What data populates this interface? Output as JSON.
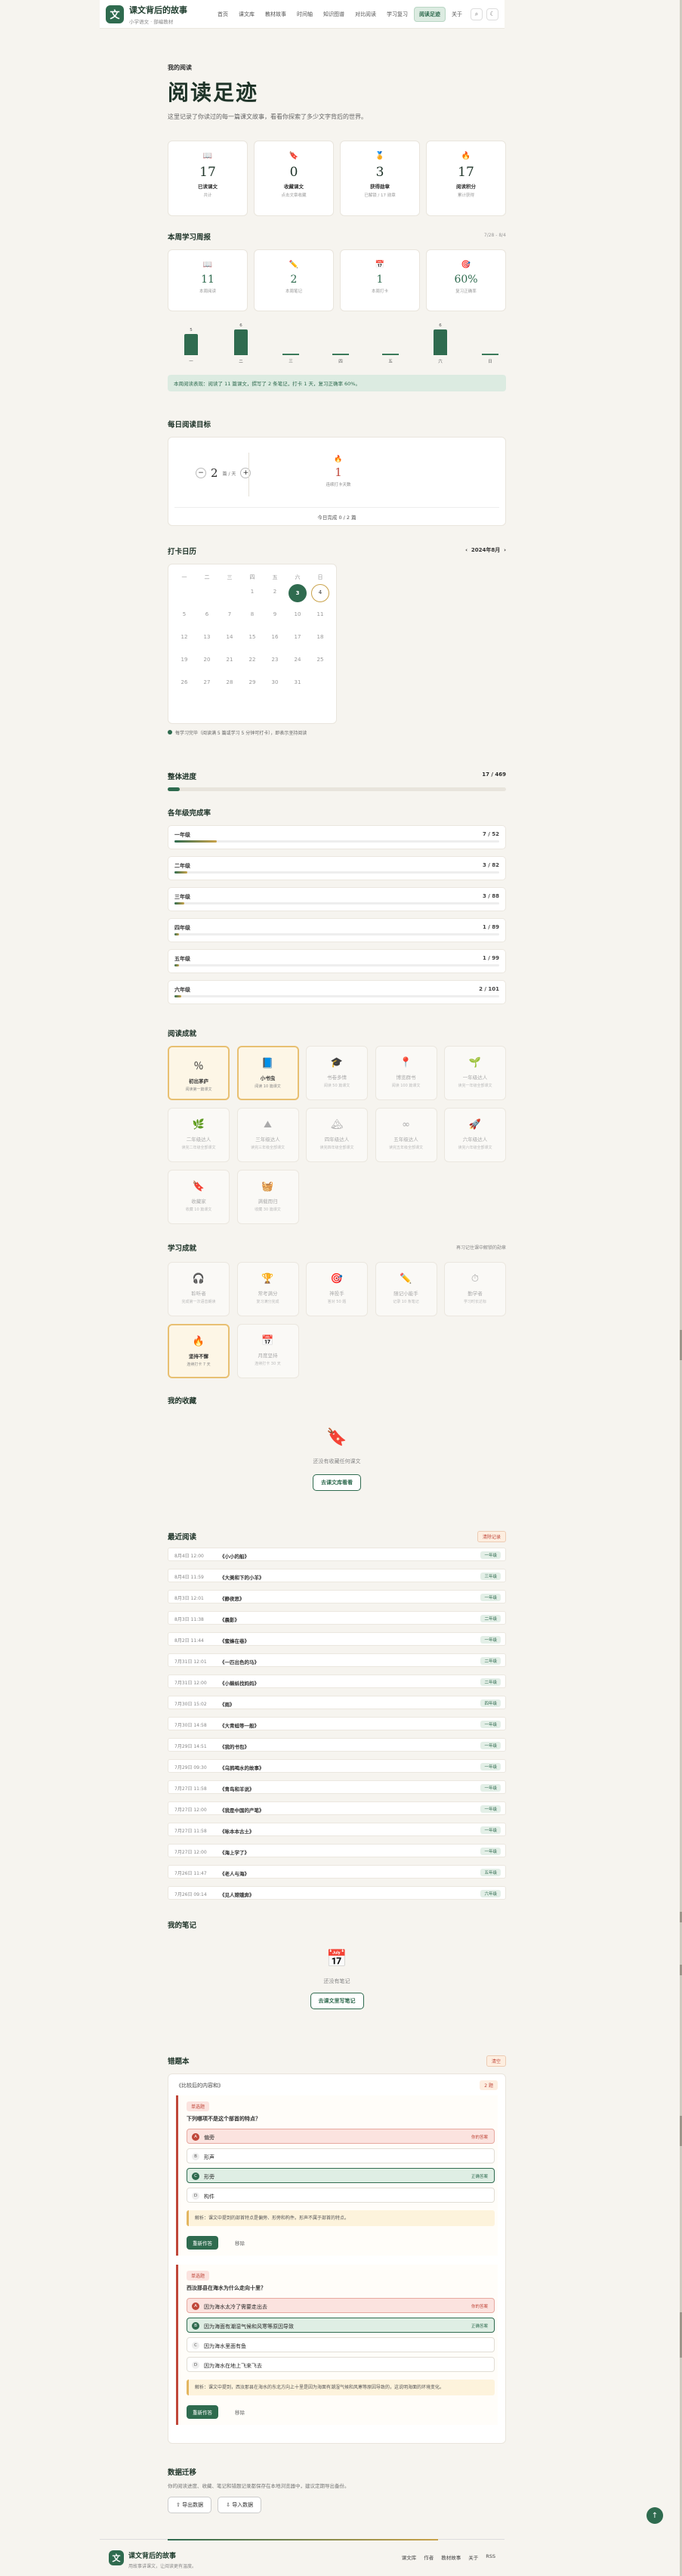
{
  "app": {
    "title": "课文背后的故事",
    "subtitle": "小学语文 · 部编教材"
  },
  "nav": [
    "首页",
    "课文库",
    "教材故事",
    "时间轴",
    "知识图谱",
    "对比阅读",
    "学习复习",
    "阅读足迹",
    "关于"
  ],
  "nav_active": "阅读足迹",
  "hero": {
    "kicker": "我的阅读",
    "title": "阅读足迹",
    "lead": "这里记录了你读过的每一篇课文故事，看看你探索了多少文字背后的世界。"
  },
  "stats": [
    {
      "icon": "📖",
      "num": "17",
      "label": "已读课文",
      "desc": "共计"
    },
    {
      "icon": "🔖",
      "num": "0",
      "label": "收藏课文",
      "desc": "点击文章收藏"
    },
    {
      "icon": "🏅",
      "num": "3",
      "label": "获得勋章",
      "desc": "已解锁 / 17 勋章"
    },
    {
      "icon": "🔥",
      "num": "17",
      "label": "阅读积分",
      "desc": "累计获得"
    }
  ],
  "week": {
    "title": "本周学习周报",
    "range": "7/28 - 8/4",
    "cards": [
      {
        "icon": "📖",
        "num": "11",
        "label": "本周阅读"
      },
      {
        "icon": "✏️",
        "num": "2",
        "label": "本周笔记"
      },
      {
        "icon": "📅",
        "num": "1",
        "label": "本周打卡"
      },
      {
        "icon": "🎯",
        "num": "60%",
        "label": "复习正确率"
      }
    ],
    "chart": {
      "days": [
        "一",
        "二",
        "三",
        "四",
        "五",
        "六",
        "日"
      ],
      "values": [
        5,
        6,
        0,
        0,
        0,
        6,
        0
      ]
    },
    "summary": "本周阅读表现：阅读了 11 篇课文，撰写了 2 条笔记，打卡 1 天，复习正确率 60%。"
  },
  "goal": {
    "title": "每日阅读目标",
    "value": "2",
    "unit": "篇 / 天",
    "flame": "🔥",
    "count": "1",
    "count_label": "连续打卡天数",
    "progress": "今日完成 0 / 2 篇"
  },
  "checkin": {
    "title": "打卡日历",
    "month": "2024年8月",
    "weekdays": [
      "一",
      "二",
      "三",
      "四",
      "五",
      "六",
      "日"
    ],
    "note": "每学习完毕（阅读满 5 篇或学习 5 分钟可打卡），即表示坚持阅读"
  },
  "overall": {
    "title": "整体进度",
    "value": "17 / 469",
    "pct": 3.6
  },
  "grades": {
    "title": "各年级完成率",
    "items": [
      {
        "name": "一年级",
        "value": "7 / 52",
        "pct": 13
      },
      {
        "name": "二年级",
        "value": "3 / 82",
        "pct": 4
      },
      {
        "name": "三年级",
        "value": "3 / 88",
        "pct": 3
      },
      {
        "name": "四年级",
        "value": "1 / 89",
        "pct": 1
      },
      {
        "name": "五年级",
        "value": "1 / 99",
        "pct": 1
      },
      {
        "name": "六年级",
        "value": "2 / 101",
        "pct": 2
      }
    ]
  },
  "achievements": {
    "title": "阅读成就",
    "items": [
      {
        "icon": "％",
        "name": "初出茅庐",
        "desc": "阅读第一篇课文",
        "on": true
      },
      {
        "icon": "📘",
        "name": "小书虫",
        "desc": "阅读 10 篇课文",
        "on": true
      },
      {
        "icon": "🎓",
        "name": "书卷多情",
        "desc": "阅读 50 篇课文",
        "on": false
      },
      {
        "icon": "📍",
        "name": "博览群书",
        "desc": "阅读 100 篇课文",
        "on": false
      },
      {
        "icon": "🌱",
        "name": "一年级达人",
        "desc": "读完一年级全部课文",
        "on": false
      },
      {
        "icon": "🌿",
        "name": "二年级达人",
        "desc": "读完二年级全部课文",
        "on": false
      },
      {
        "icon": "⛰",
        "name": "三年级达人",
        "desc": "读完三年级全部课文",
        "on": false
      },
      {
        "icon": "🏔",
        "name": "四年级达人",
        "desc": "读完四年级全部课文",
        "on": false
      },
      {
        "icon": "∞",
        "name": "五年级达人",
        "desc": "读完五年级全部课文",
        "on": false
      },
      {
        "icon": "🚀",
        "name": "六年级达人",
        "desc": "读完六年级全部课文",
        "on": false
      },
      {
        "icon": "🔖",
        "name": "收藏家",
        "desc": "收藏 10 篇课文",
        "on": false
      },
      {
        "icon": "🧺",
        "name": "满载而归",
        "desc": "收藏 30 篇课文",
        "on": false
      }
    ]
  },
  "study_ach": {
    "title": "学习成就",
    "note": "再习记住课中解锁的勋章",
    "items": [
      {
        "icon": "🎧",
        "name": "聆听者",
        "desc": "完成第一次语音朗读",
        "on": false
      },
      {
        "icon": "🏆",
        "name": "常考满分",
        "desc": "复习满分完成",
        "on": false
      },
      {
        "icon": "🎯",
        "name": "神投手",
        "desc": "答对 50 题",
        "on": false
      },
      {
        "icon": "✏️",
        "name": "随记小能手",
        "desc": "记录 10 条笔记",
        "on": false
      },
      {
        "icon": "⏱",
        "name": "勤学者",
        "desc": "学习时长达标",
        "on": false
      },
      {
        "icon": "🔥",
        "name": "坚持不懈",
        "desc": "连续打卡 7 天",
        "on": true
      },
      {
        "icon": "📅",
        "name": "月度坚持",
        "desc": "连续打卡 30 天",
        "on": false
      }
    ]
  },
  "fav": {
    "title": "我的收藏",
    "empty": "还没有收藏任何课文",
    "btn": "去课文库看看"
  },
  "recent": {
    "title": "最近阅读",
    "clear": "清除记录",
    "rows": [
      {
        "date": "8月4日 12:00",
        "title": "《小小的船》",
        "tag": "一年级"
      },
      {
        "date": "8月4日 11:59",
        "title": "《大美和下的小羊》",
        "tag": "三年级"
      },
      {
        "date": "8月3日 12:01",
        "title": "《静夜思》",
        "tag": "一年级"
      },
      {
        "date": "8月3日 11:38",
        "title": "《晨影》",
        "tag": "二年级"
      },
      {
        "date": "8月2日 11:44",
        "title": "《蜜蜂在巷》",
        "tag": "一年级"
      },
      {
        "date": "7月31日 12:01",
        "title": "《一匹出色的马》",
        "tag": "二年级"
      },
      {
        "date": "7月31日 12:00",
        "title": "《小蝌蚪找妈妈》",
        "tag": "二年级"
      },
      {
        "date": "7月30日 15:02",
        "title": "《雨》",
        "tag": "四年级"
      },
      {
        "date": "7月30日 14:58",
        "title": "《大青蛙等一般》",
        "tag": "一年级"
      },
      {
        "date": "7月29日 14:51",
        "title": "《我的书包》",
        "tag": "一年级"
      },
      {
        "date": "7月29日 09:30",
        "title": "《乌鸦喝水的故事》",
        "tag": "一年级"
      },
      {
        "date": "7月27日 11:58",
        "title": "《青鸟和羊说》",
        "tag": "一年级"
      },
      {
        "date": "7月27日 12:00",
        "title": "《我是中国的产笔》",
        "tag": "一年级"
      },
      {
        "date": "7月27日 11:58",
        "title": "《咏本本古土》",
        "tag": "一年级"
      },
      {
        "date": "7月27日 12:00",
        "title": "《海上学了》",
        "tag": "一年级"
      },
      {
        "date": "7月26日 11:47",
        "title": "《老人与海》",
        "tag": "五年级"
      },
      {
        "date": "7月26日 09:14",
        "title": "《见人嫦娥奔》",
        "tag": "六年级"
      }
    ]
  },
  "notes": {
    "title": "我的笔记",
    "empty": "还没有笔记",
    "btn": "去课文里写笔记"
  },
  "wrongbook": {
    "title": "错题本",
    "clear": "清空",
    "source": "《比较后的内容和》",
    "count": "2 题",
    "q": [
      {
        "badge": "单选题",
        "text": "下列哪项不是这个部首的特点？",
        "opts": [
          {
            "c": "A",
            "t": "偏旁",
            "st": "你的答案",
            "kind": "wr"
          },
          {
            "c": "B",
            "t": "形声",
            "st": "",
            "kind": ""
          },
          {
            "c": "C",
            "t": "形旁",
            "st": "正确答案",
            "kind": "ok"
          },
          {
            "c": "D",
            "t": "构件",
            "st": "",
            "kind": ""
          }
        ],
        "expl": "解析：课文中提到的部首特点是偏旁、形旁和构件。形声不属于部首的特点。",
        "retry": "重新作答",
        "del": "移除"
      },
      {
        "badge": "单选题",
        "text": "西汝那县在海水为什么走向十里？",
        "opts": [
          {
            "c": "A",
            "t": "因为海水太冷了需要走出去",
            "st": "你的答案",
            "kind": "wr"
          },
          {
            "c": "B",
            "t": "因为海面有潮湿气候和风寒等原因导致",
            "st": "正确答案",
            "kind": "ok"
          },
          {
            "c": "C",
            "t": "因为海水里面有鱼",
            "st": "",
            "kind": ""
          },
          {
            "c": "D",
            "t": "因为海水在地上飞来飞去",
            "st": "",
            "kind": ""
          }
        ],
        "expl": "解析：课文中提到，西汝那县在海水的东北方向上十里是因为海面有潮湿气候和风寒等原因导致的，这说明海面的环境变化。",
        "retry": "重新作答",
        "del": "移除"
      }
    ]
  },
  "backup": {
    "title": "数据迁移",
    "desc": "你的阅读进度、收藏、笔记和错题记录都保存在本地浏览器中，建议定期导出备份。",
    "export": "导出数据",
    "import": "导入数据"
  },
  "footer": {
    "title": "课文背后的故事",
    "sub": "用故事讲课文，让阅读更有温度。",
    "links": [
      "课文库",
      "作者",
      "教材故事",
      "关于",
      "RSS"
    ]
  }
}
